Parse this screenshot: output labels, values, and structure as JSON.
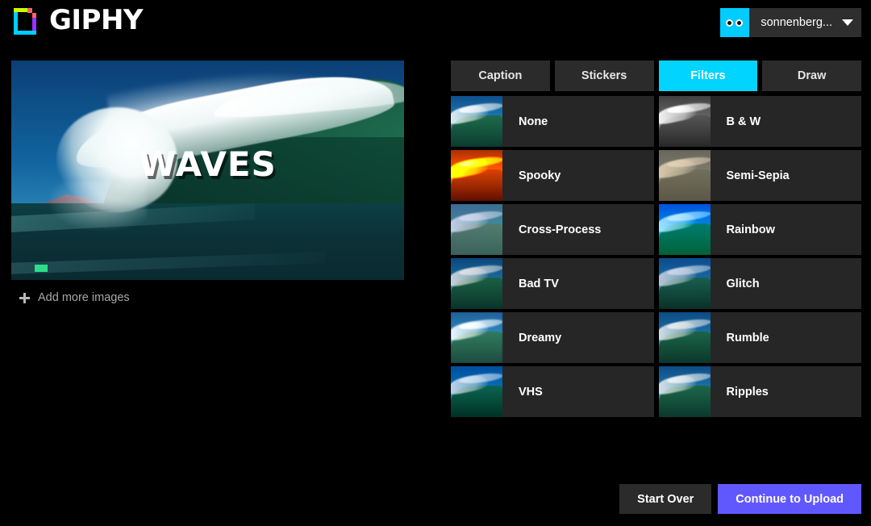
{
  "brand": {
    "name": "GIPHY",
    "logo_icon": "giphy-logo-icon",
    "logo_colors": {
      "left": "#00ccff",
      "top": "#ccff00",
      "right": "#9933ff",
      "bottom": "#00ccff",
      "corner": "#ff6666"
    }
  },
  "account": {
    "username": "sonnenberg...",
    "avatar_icon": "eyes-avatar-icon",
    "avatar_color": "#00ccff",
    "caret_icon": "chevron-down-icon"
  },
  "preview": {
    "caption": "WAVES",
    "marker_color": "#2bdf8a",
    "add_more_label": "Add more images",
    "add_more_icon": "plus-icon"
  },
  "tabs": [
    {
      "label": "Caption",
      "active": false
    },
    {
      "label": "Stickers",
      "active": false
    },
    {
      "label": "Filters",
      "active": true
    },
    {
      "label": "Draw",
      "active": false
    }
  ],
  "accent_color": "#00d4ff",
  "filters": [
    {
      "label": "None",
      "tint": "none"
    },
    {
      "label": "B & W",
      "tint": "bw"
    },
    {
      "label": "Spooky",
      "tint": "spooky"
    },
    {
      "label": "Semi-Sepia",
      "tint": "sepia"
    },
    {
      "label": "Cross-Process",
      "tint": "cross"
    },
    {
      "label": "Rainbow",
      "tint": "rainbow"
    },
    {
      "label": "Bad TV",
      "tint": "badtv"
    },
    {
      "label": "Glitch",
      "tint": "glitch"
    },
    {
      "label": "Dreamy",
      "tint": "dreamy"
    },
    {
      "label": "Rumble",
      "tint": "rumble"
    },
    {
      "label": "VHS",
      "tint": "vhs"
    },
    {
      "label": "Ripples",
      "tint": "ripples"
    }
  ],
  "footer": {
    "start_over_label": "Start Over",
    "continue_label": "Continue to Upload",
    "continue_color": "#6157ff"
  }
}
